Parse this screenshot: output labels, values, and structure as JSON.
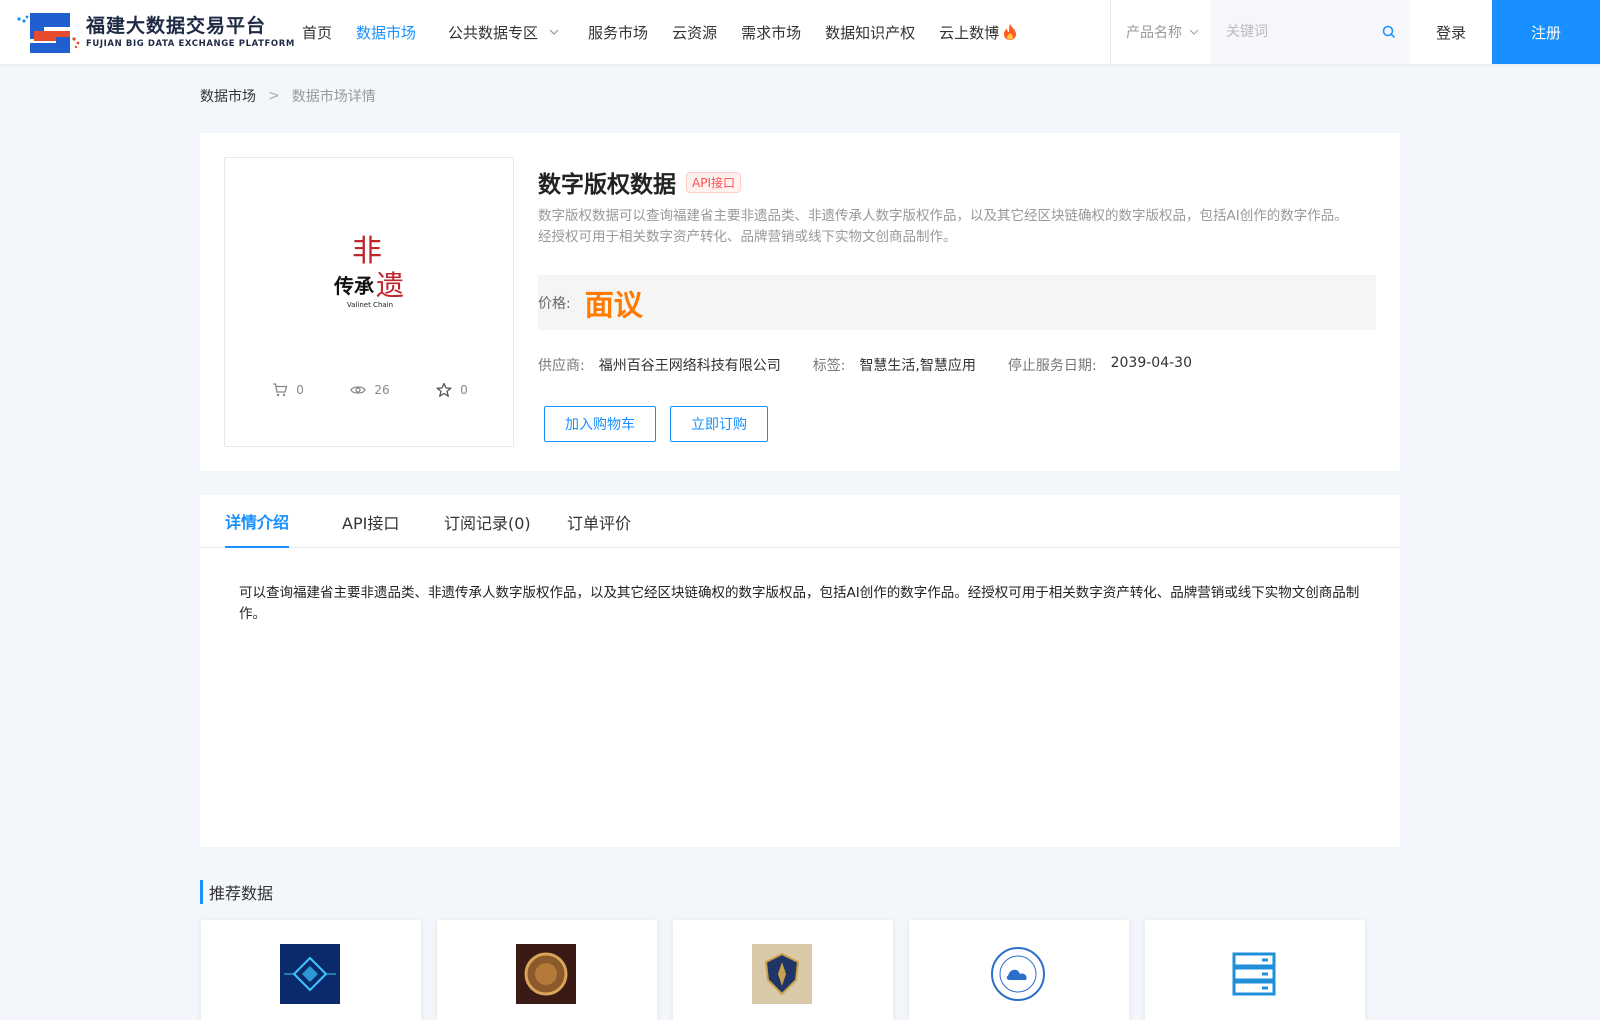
{
  "header": {
    "logo_cn": "福建大数据交易平台",
    "logo_en": "FUJIAN BIG DATA EXCHANGE  PLATFORM",
    "nav": [
      {
        "label": "首页"
      },
      {
        "label": "数据市场",
        "active": true
      },
      {
        "label": "公共数据专区",
        "dropdown": true
      },
      {
        "label": "服务市场"
      },
      {
        "label": "云资源"
      },
      {
        "label": "需求市场"
      },
      {
        "label": "数据知识产权"
      },
      {
        "label": "云上数博",
        "icon": "fire-icon"
      }
    ],
    "search_category": "产品名称",
    "search_placeholder": "关键词",
    "login": "登录",
    "register": "注册"
  },
  "breadcrumb": {
    "home": "数据市场",
    "separator": ">",
    "current": "数据市场详情"
  },
  "product": {
    "image_caption": "Valinet Chain",
    "image_text_top": "非",
    "image_text_bottom": "传承",
    "image_text_right": "遗",
    "stats": {
      "cart": "0",
      "views": "26",
      "favorites": "0"
    },
    "title": "数字版权数据",
    "type_badge": "API接口",
    "description": "数字版权数据可以查询福建省主要非遗品类、非遗传承人数字版权作品，以及其它经区块链确权的数字版权品，包括AI创作的数字作品。经授权可用于相关数字资产转化、品牌营销或线下实物文创商品制作。",
    "price_label": "价格:",
    "price_value": "面议",
    "supplier_label": "供应商:",
    "supplier": "福州百谷王网络科技有限公司",
    "tags_label": "标签:",
    "tags": "智慧生活,智慧应用",
    "stop_label": "停止服务日期:",
    "stop_date": "2039-04-30",
    "add_cart": "加入购物车",
    "subscribe": "立即订购"
  },
  "tabs": [
    {
      "label": "详情介绍",
      "active": true
    },
    {
      "label": "API接口"
    },
    {
      "label": "订阅记录(0)"
    },
    {
      "label": "订单评价"
    }
  ],
  "detail_text": "可以查询福建省主要非遗品类、非遗传承人数字版权作品，以及其它经区块链确权的数字版权品，包括AI创作的数字作品。经授权可用于相关数字资产转化、品牌营销或线下实物文创商品制作。",
  "recommend": {
    "title": "推荐数据"
  },
  "colors": {
    "accent": "#1890ff",
    "price": "#ff7a00",
    "badge": "#ff4d4f"
  }
}
